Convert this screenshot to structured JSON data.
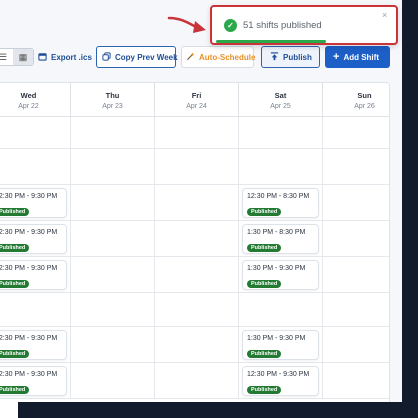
{
  "toast": {
    "message": "51 shifts published",
    "close": "×",
    "progress_fraction": 0.6
  },
  "toolbar": {
    "list_view_icon": "☰",
    "grid_view_icon": "▦",
    "export_icon": "calendar-icon",
    "export_label": "Export .ics",
    "copy_icon": "copy-icon",
    "copy_label": "Copy Prev Week",
    "auto_icon": "wand-icon",
    "auto_label": "Auto-Schedule",
    "publish_icon": "upload-icon",
    "publish_label": "Publish",
    "add_icon": "+",
    "add_label": "Add Shift"
  },
  "calendar": {
    "days": [
      {
        "name": "Wed",
        "date": "Apr 22"
      },
      {
        "name": "Thu",
        "date": "Apr 23"
      },
      {
        "name": "Fri",
        "date": "Apr 24"
      },
      {
        "name": "Sat",
        "date": "Apr 25"
      },
      {
        "name": "Sun",
        "date": "Apr 26"
      }
    ],
    "rows": [
      {
        "cells": [
          null,
          null,
          null,
          null,
          null
        ]
      },
      {
        "cells": [
          null,
          null,
          null,
          null,
          null
        ]
      },
      {
        "cells": [
          {
            "time": "12:30 PM - 9:30 PM",
            "status": "Published"
          },
          null,
          null,
          {
            "time": "12:30 PM - 8:30 PM",
            "status": "Published"
          },
          null
        ]
      },
      {
        "cells": [
          {
            "time": "12:30 PM - 9:30 PM",
            "status": "Published"
          },
          null,
          null,
          {
            "time": "1:30 PM - 8:30 PM",
            "status": "Published"
          },
          null
        ]
      },
      {
        "cells": [
          {
            "time": "12:30 PM - 9:30 PM",
            "status": "Published"
          },
          null,
          null,
          {
            "time": "1:30 PM - 9:30 PM",
            "status": "Published"
          },
          null
        ]
      },
      {
        "cells": [
          null,
          null,
          null,
          null,
          null
        ]
      },
      {
        "cells": [
          {
            "time": "12:30 PM - 9:30 PM",
            "status": "Published"
          },
          null,
          null,
          {
            "time": "1:30 PM - 9:30 PM",
            "status": "Published"
          },
          null
        ]
      },
      {
        "cells": [
          {
            "time": "12:30 PM - 9:30 PM",
            "status": "Published"
          },
          null,
          null,
          {
            "time": "12:30 PM - 9:30 PM",
            "status": "Published"
          },
          null
        ]
      }
    ]
  },
  "colors": {
    "primary": "#1c5fc7",
    "published_badge": "#237a32",
    "toast_border": "#c9333a",
    "success": "#2ba84a",
    "auto_schedule": "#e8912a"
  }
}
